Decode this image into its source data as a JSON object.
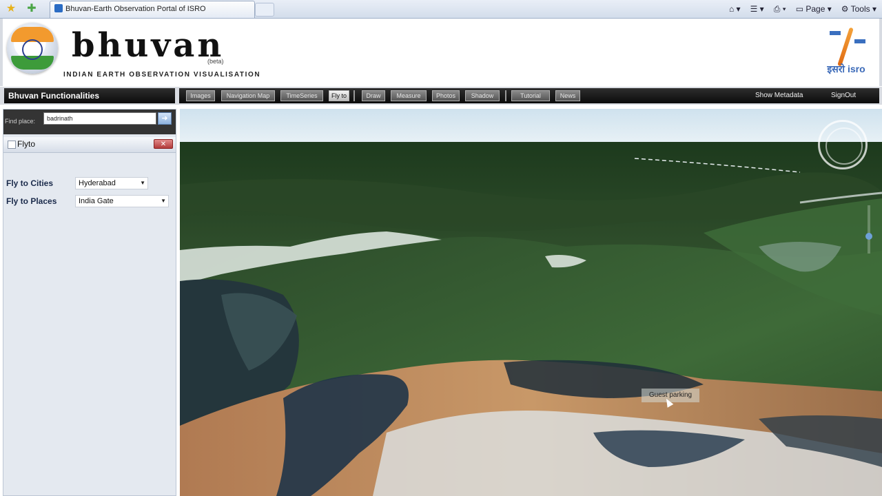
{
  "browser": {
    "tab_title": "Bhuvan-Earth Observation Portal of ISRO",
    "commands": [
      "Page",
      "Tools"
    ]
  },
  "header": {
    "brand": "bhuvan",
    "beta": "(beta)",
    "tagline": "INDIAN EARTH OBSERVATION VISUALISATION",
    "isro_logo_text": "इसरो isro"
  },
  "toolbar": {
    "title": "Bhuvan Functionalities",
    "buttons": [
      "Images",
      "Navigation Map",
      "TimeSeries",
      "Fly to",
      "Draw",
      "Measure",
      "Photos",
      "Shadow",
      "Tutorial",
      "News"
    ],
    "active_button": "Fly to",
    "links": [
      "Show Metadata",
      "SignOut"
    ]
  },
  "sidebar": {
    "find_label": "Find place:",
    "find_value": "badrinath",
    "flyto_title": "Flyto",
    "fly_cities_label": "Fly to Cities",
    "fly_cities_value": "Hyderabad",
    "fly_places_label": "Fly to Places",
    "fly_places_value": "India Gate"
  },
  "map": {
    "tooltip": "Guest parking"
  }
}
